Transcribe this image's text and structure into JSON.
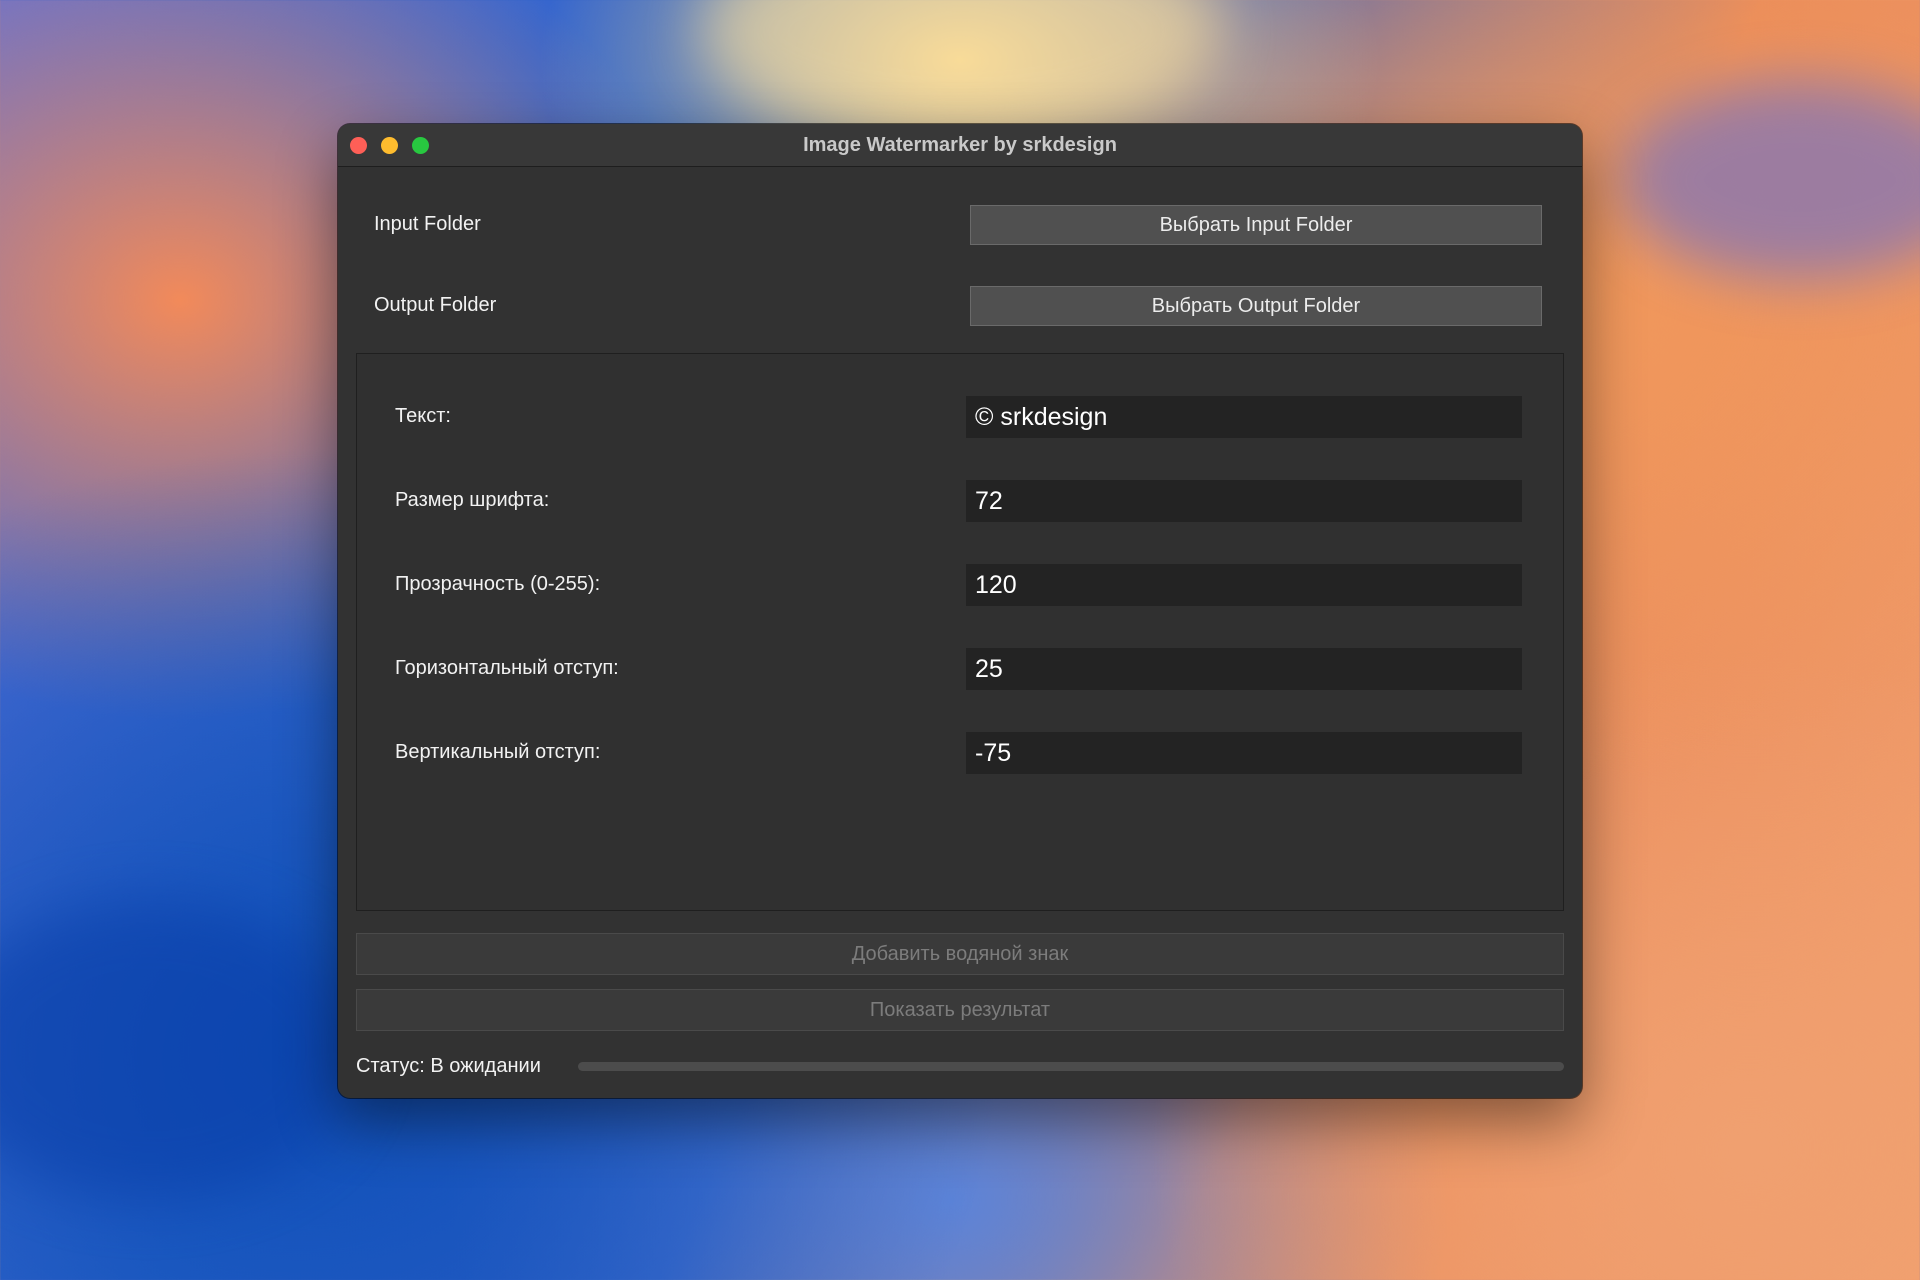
{
  "window": {
    "title": "Image Watermarker by srkdesign"
  },
  "folders": {
    "input_label": "Input Folder",
    "input_button": "Выбрать Input Folder",
    "output_label": "Output Folder",
    "output_button": "Выбрать Output Folder"
  },
  "settings": {
    "text_label": "Текст:",
    "text_value": "© srkdesign",
    "font_size_label": "Размер шрифта:",
    "font_size_value": "72",
    "opacity_label": "Прозрачность (0-255):",
    "opacity_value": "120",
    "h_offset_label": "Горизонтальный отступ:",
    "h_offset_value": "25",
    "v_offset_label": "Вертикальный отступ:",
    "v_offset_value": "-75"
  },
  "actions": {
    "add_watermark": "Добавить водяной знак",
    "show_result": "Показать результат"
  },
  "status": {
    "text": "Статус: В ожидании",
    "progress_percent": 0
  },
  "colors": {
    "close": "#fe5f57",
    "minimize": "#febc2e",
    "maximize": "#28c840"
  }
}
